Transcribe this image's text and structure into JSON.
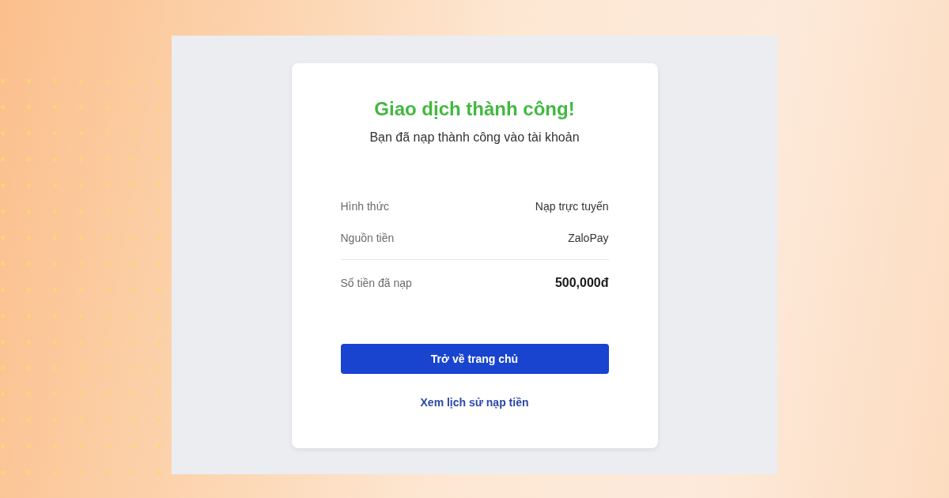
{
  "card": {
    "title": "Giao dịch thành công!",
    "subtitle": "Bạn đã nạp thành công vào tài khoản",
    "details": [
      {
        "kind": "normal",
        "label": "Hình thức",
        "value": "Nạp trực tuyến"
      },
      {
        "kind": "normal",
        "label": "Nguồn tiền",
        "value": "ZaloPay"
      },
      {
        "kind": "total",
        "label": "Số tiền đã nạp",
        "value": "500,000đ"
      }
    ],
    "primary_button": "Trở về trang chủ",
    "link": "Xem lịch sử nạp tiền"
  }
}
